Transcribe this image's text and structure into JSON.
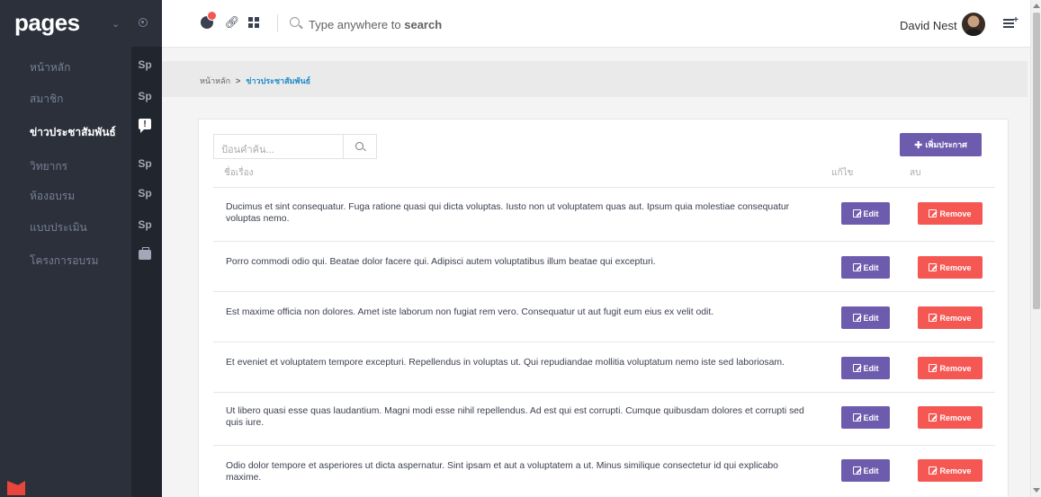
{
  "sidebar": {
    "brand": "pages",
    "items": [
      {
        "label": "หน้าหลัก",
        "badge": "Sp",
        "active": false
      },
      {
        "label": "สมาชิก",
        "badge": "Sp",
        "active": false
      },
      {
        "label": "ข่าวประชาสัมพันธ์",
        "badge": "!",
        "active": true
      },
      {
        "label": "วิทยากร",
        "badge": "Sp",
        "active": false
      },
      {
        "label": "ห้องอบรม",
        "badge": "Sp",
        "active": false
      },
      {
        "label": "แบบประเมิน",
        "badge": "Sp",
        "active": false
      },
      {
        "label": "โครงการอบรม",
        "badge": "",
        "active": false
      }
    ]
  },
  "header": {
    "search_prefix": "Type anywhere to ",
    "search_bold": "search",
    "user_name": "David Nest"
  },
  "breadcrumb": {
    "home": "หน้าหลัก",
    "current": "ข่าวประชาสัมพันธ์"
  },
  "table": {
    "search_placeholder": "ป้อนคำค้น...",
    "add_label": "เพิ่มประกาศ",
    "col_title": "ชื่อเรื่อง",
    "col_edit": "แก้ไข",
    "col_delete": "ลบ",
    "edit_label": "Edit",
    "remove_label": "Remove",
    "rows": [
      "Ducimus et sint consequatur. Fuga ratione quasi qui dicta voluptas. Iusto non ut voluptatem quas aut. Ipsum quia molestiae consequatur voluptas nemo.",
      "Porro commodi odio qui. Beatae dolor facere qui. Adipisci autem voluptatibus illum beatae qui excepturi.",
      "Est maxime officia non dolores. Amet iste laborum non fugiat rem vero. Consequatur ut aut fugit eum eius ex velit odit.",
      "Et eveniet et voluptatem tempore excepturi. Repellendus in voluptas ut. Qui repudiandae mollitia voluptatum nemo iste sed laboriosam.",
      "Ut libero quasi esse quas laudantium. Magni modi esse nihil repellendus. Ad est qui est corrupti. Cumque quibusdam dolores et corrupti sed quis iure.",
      "Odio dolor tempore et asperiores ut dicta aspernatur. Sint ipsam et aut a voluptatem a ut. Minus similique consectetur id qui explicabo maxime."
    ]
  },
  "colors": {
    "sidebar_bg": "#2b303b",
    "primary": "#6d5cae",
    "danger": "#f55753",
    "link": "#1f8ac9"
  }
}
